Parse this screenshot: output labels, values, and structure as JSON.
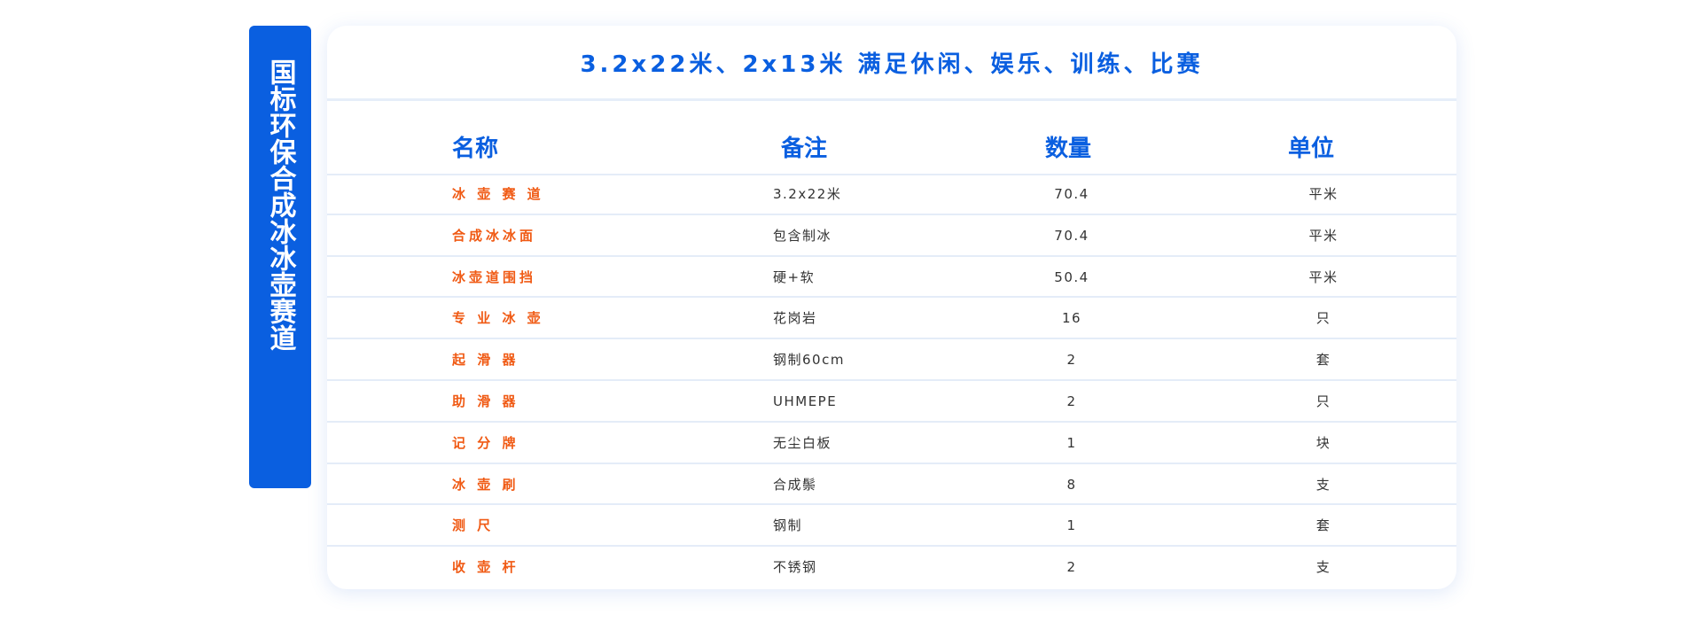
{
  "side_tab": {
    "label": "国标环保合成冰冰壶赛道"
  },
  "card": {
    "title": "3.2x22米、2x13米 满足休闲、娱乐、训练、比赛"
  },
  "table": {
    "headers": [
      "名称",
      "备注",
      "数量",
      "单位"
    ],
    "rows": [
      {
        "name": "冰 壶 赛 道",
        "note": "3.2x22米",
        "qty": "70.4",
        "unit": "平米"
      },
      {
        "name": "合成冰冰面",
        "note": "包含制冰",
        "qty": "70.4",
        "unit": "平米"
      },
      {
        "name": "冰壶道围挡",
        "note": "硬+软",
        "qty": "50.4",
        "unit": "平米"
      },
      {
        "name": "专 业 冰 壶",
        "note": "花岗岩",
        "qty": "16",
        "unit": "只"
      },
      {
        "name": "起 滑 器",
        "note": "钢制60cm",
        "qty": "2",
        "unit": "套"
      },
      {
        "name": "助 滑 器",
        "note": "UHMEPE",
        "qty": "2",
        "unit": "只"
      },
      {
        "name": "记 分 牌",
        "note": "无尘白板",
        "qty": "1",
        "unit": "块"
      },
      {
        "name": "冰 壶 刷",
        "note": "合成鬃",
        "qty": "8",
        "unit": "支"
      },
      {
        "name": "测 尺",
        "note": "钢制",
        "qty": "1",
        "unit": "套"
      },
      {
        "name": "收 壶 杆",
        "note": "不锈钢",
        "qty": "2",
        "unit": "支"
      }
    ]
  },
  "colors": {
    "accent": "#0a5fe0",
    "name_text": "#f05a14",
    "divider": "#e4ecf8"
  }
}
